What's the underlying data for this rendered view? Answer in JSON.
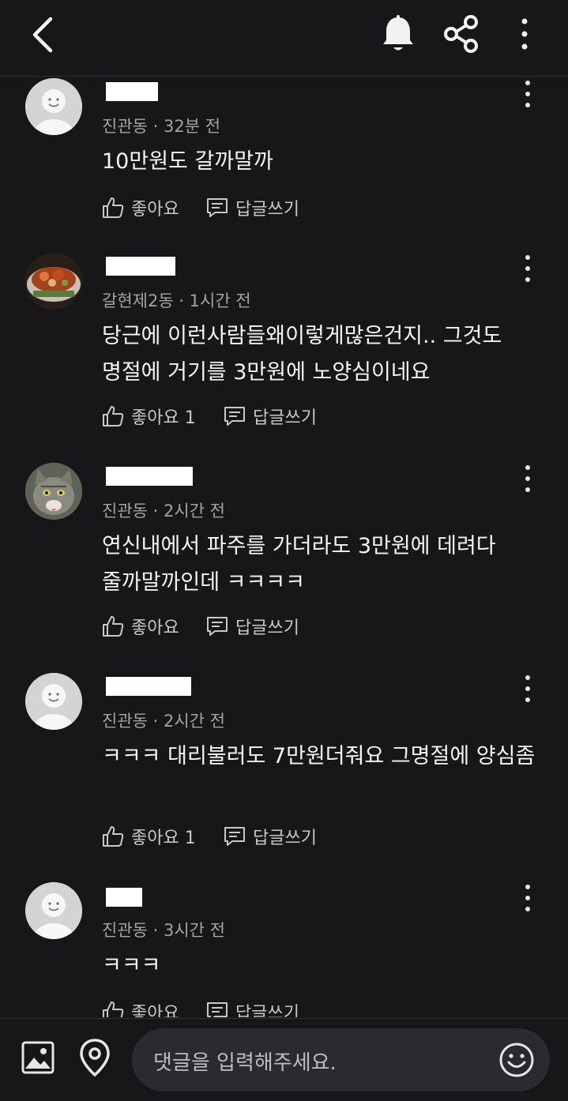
{
  "header": {
    "back_icon": "chevron-left-icon",
    "bell_icon": "bell-icon",
    "share_icon": "share-icon",
    "more_icon": "vertical-ellipsis-icon"
  },
  "comments": [
    {
      "avatar": "default-profile",
      "meta": "진관동 · 32분 전",
      "text": "10만원도 갈까말까",
      "like_label": "좋아요",
      "reply_label": "답글쓰기"
    },
    {
      "avatar": "food-photo",
      "meta": "갈현제2동 · 1시간 전",
      "text": "당근에 이런사람들왜이렇게많은건지.. 그것도 명절에 거기를 3만원에 노양심이네요",
      "like_label": "좋아요 1",
      "reply_label": "답글쓰기"
    },
    {
      "avatar": "cat-photo",
      "meta": "진관동 · 2시간 전",
      "text": "연신내에서 파주를 가더라도 3만원에 데려다 줄까말까인데 ㅋㅋㅋㅋ",
      "like_label": "좋아요",
      "reply_label": "답글쓰기"
    },
    {
      "avatar": "default-profile",
      "meta": "진관동 · 2시간 전",
      "text": "ㅋㅋㅋ 대리불러도 7만원더줘요 그명절에 양심좀",
      "like_label": "좋아요 1",
      "reply_label": "답글쓰기"
    },
    {
      "avatar": "default-profile",
      "meta": "진관동 · 3시간 전",
      "text": "ㅋㅋㅋ",
      "like_label": "좋아요",
      "reply_label": "답글쓰기"
    }
  ],
  "composer": {
    "placeholder": "댓글을 입력해주세요.",
    "gallery_icon": "image-icon",
    "location_icon": "location-pin-icon",
    "emoji_icon": "smiley-icon"
  }
}
